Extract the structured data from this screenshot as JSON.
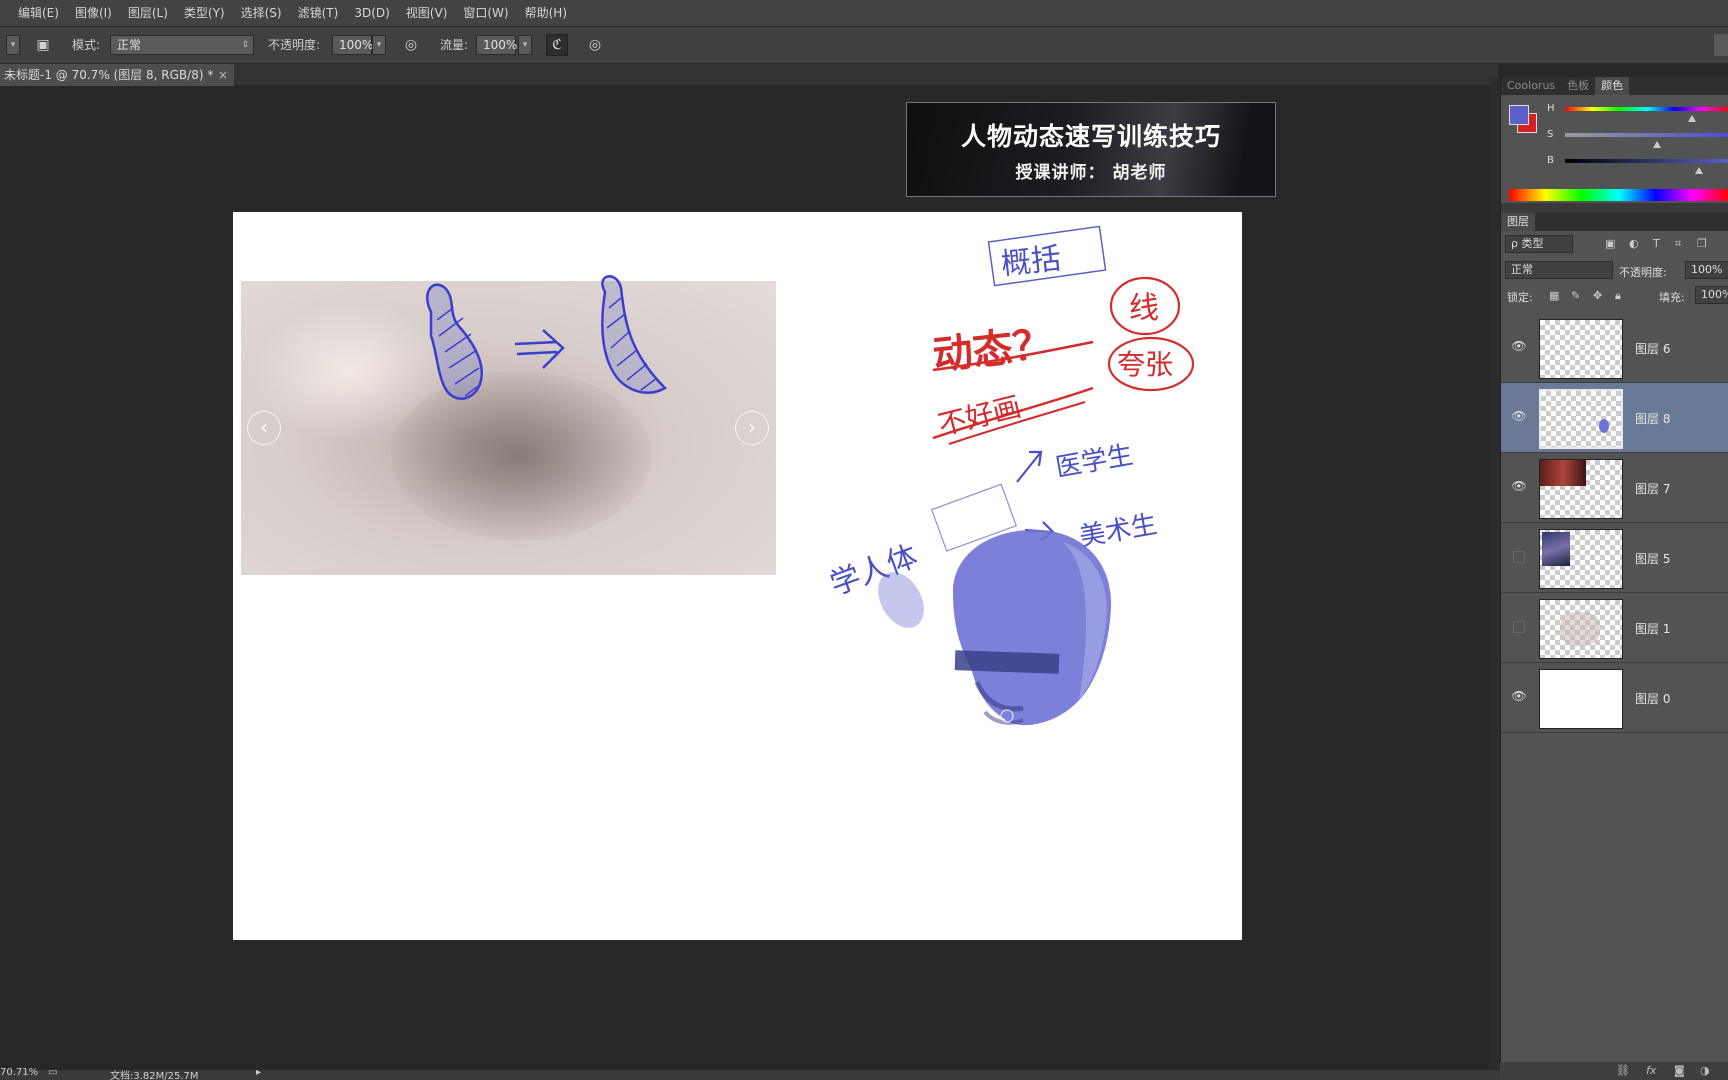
{
  "menubar": {
    "items": [
      "编辑(E)",
      "图像(I)",
      "图层(L)",
      "类型(Y)",
      "选择(S)",
      "滤镜(T)",
      "3D(D)",
      "视图(V)",
      "窗口(W)",
      "帮助(H)"
    ]
  },
  "options": {
    "mode_label": "模式:",
    "mode_value": "正常",
    "opacity_label": "不透明度:",
    "opacity_value": "100%",
    "flow_label": "流量:",
    "flow_value": "100%"
  },
  "document_tab": {
    "title": "未标题-1 @ 70.7% (图层 8, RGB/8) *",
    "close": "×"
  },
  "banner": {
    "title": "人物动态速写训练技巧",
    "subtitle": "授课讲师：  胡老师"
  },
  "canvas": {
    "prev_arrow": "‹",
    "next_arrow": "›",
    "sketch_text": {
      "gaikuo": "概括",
      "dongtai": "动态？",
      "buduidongtai": "不好画",
      "xian": "线",
      "kuazhang": "夸张",
      "xuerenti": "学人体",
      "yixuesheng": "医学生",
      "meishusheng": "美术生"
    }
  },
  "color_panel": {
    "tabs": [
      "Coolorus",
      "色板",
      "颜色"
    ],
    "active_tab": "颜色",
    "labels": [
      "H",
      "S",
      "B"
    ],
    "foreground": "#5a5fc9",
    "background": "#d42121"
  },
  "layers_panel": {
    "title": "图层",
    "filter_label": "ρ 类型",
    "blend_mode": "正常",
    "opacity_label": "不透明度:",
    "opacity_value": "100%",
    "lock_label": "锁定:",
    "fill_label": "填充:",
    "fill_value": "100%",
    "layers": [
      {
        "name": "图层 6",
        "visible": true,
        "selected": false
      },
      {
        "name": "图层 8",
        "visible": true,
        "selected": true
      },
      {
        "name": "图层 7",
        "visible": true,
        "selected": false
      },
      {
        "name": "图层 5",
        "visible": false,
        "selected": false
      },
      {
        "name": "图层 1",
        "visible": false,
        "selected": false
      },
      {
        "name": "图层 0",
        "visible": true,
        "selected": false
      }
    ]
  },
  "statusbar": {
    "zoom": "70.71%",
    "doc": "文档:3.82M/25.7M"
  }
}
